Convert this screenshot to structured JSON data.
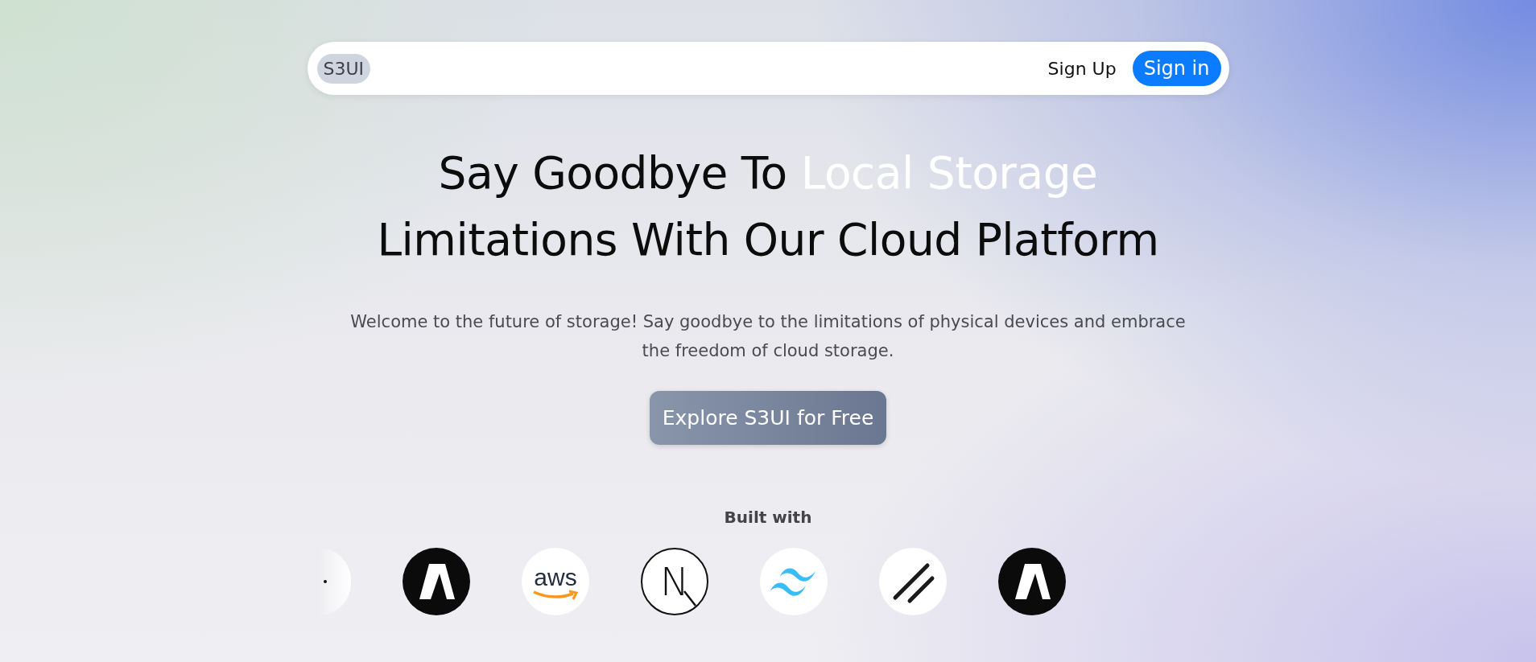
{
  "navbar": {
    "logo": "S3UI",
    "links": [
      {
        "label": "Sign Up",
        "kind": "plain"
      },
      {
        "label": "Sign in",
        "kind": "primary"
      }
    ]
  },
  "hero": {
    "headline_lines": [
      [
        {
          "text": "Say Goodbye To ",
          "highlight": false
        },
        {
          "text": "Local Storage",
          "highlight": true
        }
      ],
      [
        {
          "text": "Limitations With Our Cloud Platform",
          "highlight": false
        }
      ]
    ],
    "description": "Welcome to the future of storage! Say goodbye to the limitations of physical devices and embrace the freedom of cloud storage.",
    "cta": "Explore S3UI for Free"
  },
  "built_with": {
    "title": "Built with",
    "logos": [
      {
        "kind": "fragment"
      },
      {
        "kind": "angular-a"
      },
      {
        "kind": "aws",
        "label": "aws"
      },
      {
        "kind": "next",
        "label": "N"
      },
      {
        "kind": "tailwind"
      },
      {
        "kind": "slashes"
      },
      {
        "kind": "angular-a"
      }
    ]
  }
}
